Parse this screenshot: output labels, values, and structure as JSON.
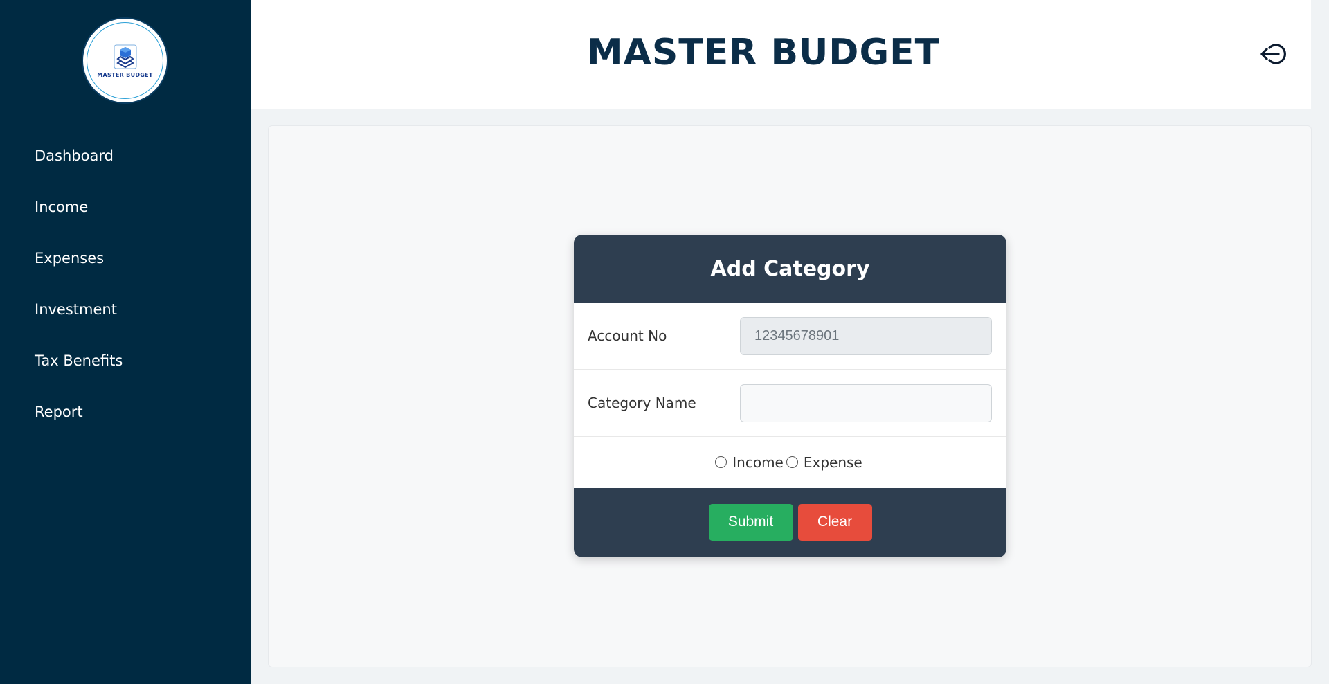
{
  "brand": {
    "logo_text": "MASTER BUDGET",
    "page_title": "MASTER BUDGET"
  },
  "sidebar": {
    "items": [
      {
        "label": "Dashboard"
      },
      {
        "label": "Income"
      },
      {
        "label": "Expenses"
      },
      {
        "label": "Investment"
      },
      {
        "label": "Tax Benefits"
      },
      {
        "label": "Report"
      }
    ]
  },
  "header": {
    "logout_icon": "logout-icon"
  },
  "form": {
    "title": "Add Category",
    "account_label": "Account No",
    "account_value": "12345678901",
    "category_label": "Category Name",
    "category_value": "",
    "radio_income": "Income",
    "radio_expense": "Expense",
    "submit_label": "Submit",
    "clear_label": "Clear"
  },
  "colors": {
    "sidebar_bg": "#002a42",
    "form_header_bg": "#2e3e50",
    "submit": "#27ae60",
    "clear": "#e74c3c",
    "title": "#0b2d48"
  }
}
